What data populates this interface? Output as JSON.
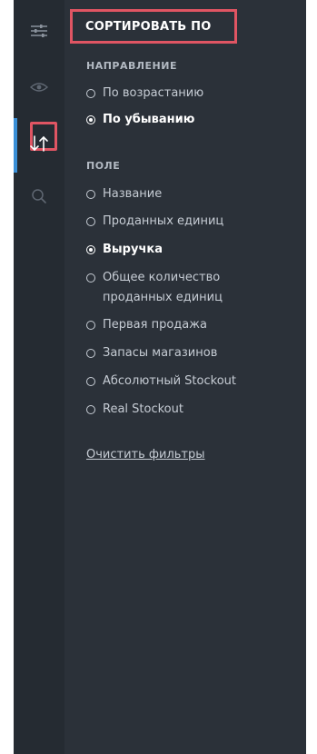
{
  "rail": {
    "items": [
      {
        "icon": "sliders-icon"
      },
      {
        "icon": "eye-icon"
      },
      {
        "icon": "sort-icon",
        "active": true
      },
      {
        "icon": "search-icon"
      }
    ]
  },
  "panel": {
    "title": "СОРТИРОВАТЬ ПО",
    "direction": {
      "label": "НАПРАВЛЕНИЕ",
      "options": [
        {
          "label": "По возрастанию",
          "selected": false
        },
        {
          "label": "По убыванию",
          "selected": true
        }
      ]
    },
    "field": {
      "label": "ПОЛЕ",
      "options": [
        {
          "label": "Название",
          "selected": false
        },
        {
          "label": "Проданных единиц",
          "selected": false
        },
        {
          "label": "Выручка",
          "selected": true
        },
        {
          "label": "Общее количество проданных единиц",
          "selected": false
        },
        {
          "label": "Первая продажа",
          "selected": false
        },
        {
          "label": "Запасы магазинов",
          "selected": false
        },
        {
          "label": "Абсолютный Stockout",
          "selected": false
        },
        {
          "label": "Real Stockout",
          "selected": false
        }
      ]
    },
    "clear_filters": "Очистить фильтры"
  },
  "colors": {
    "panel_bg": "#2b3139",
    "rail_bg": "#252b32",
    "highlight": "#e05563",
    "active_accent": "#3a8fd6"
  }
}
